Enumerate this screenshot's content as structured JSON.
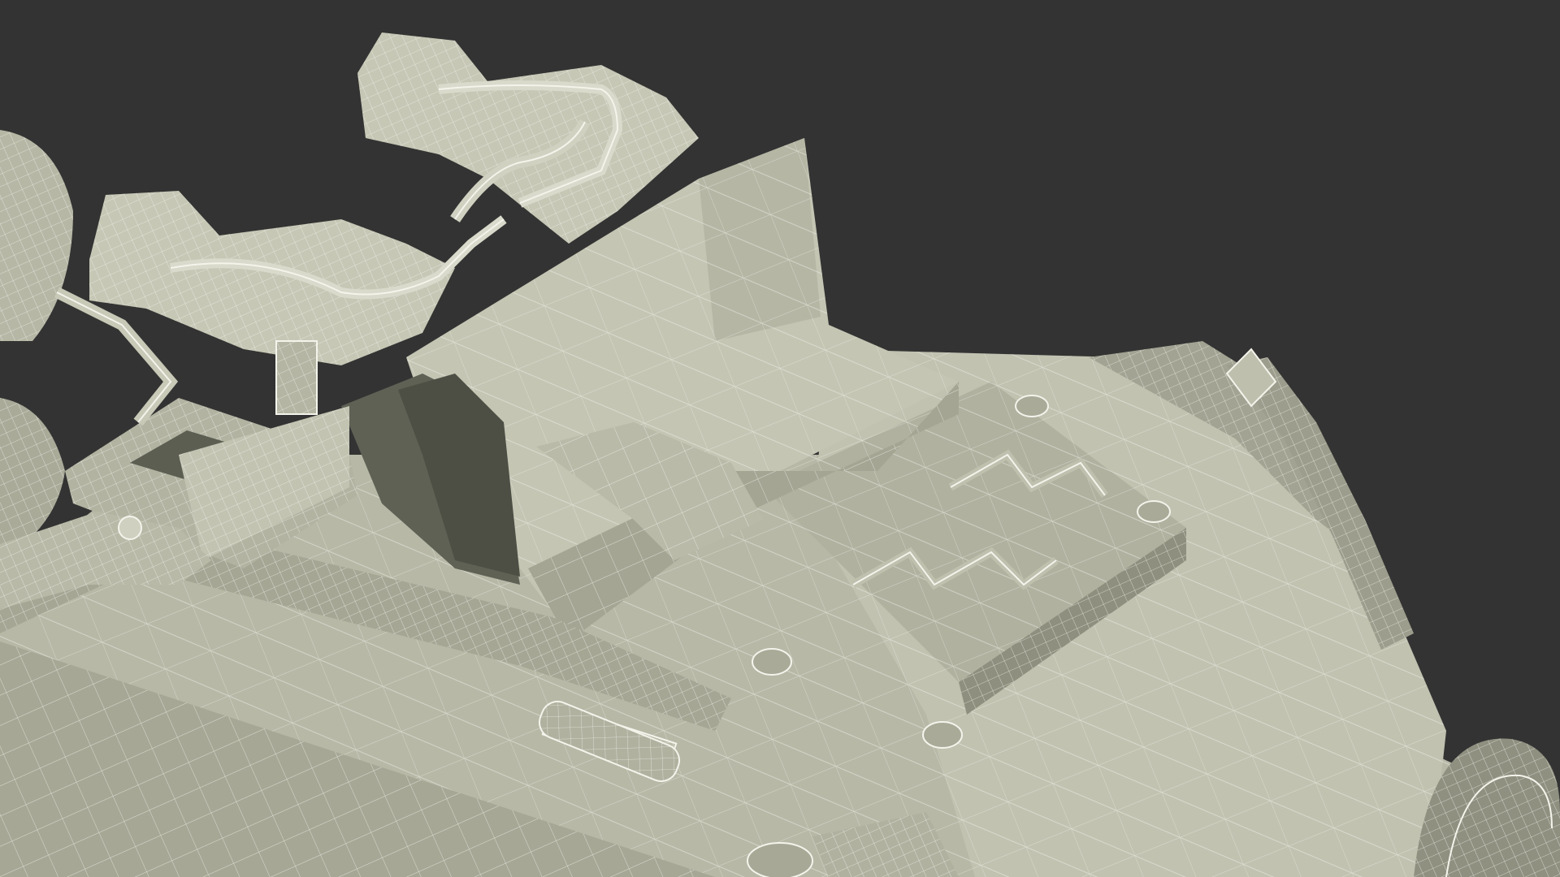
{
  "scene": {
    "subject": "wireframe-3d-vehicle-render",
    "background_color": "#333333",
    "hull_light": "#c9cab9",
    "hull_mid": "#a9aa98",
    "hull_dark": "#7f8172",
    "hull_shadow": "#55574c",
    "wire_color": "#f4f4ec"
  }
}
